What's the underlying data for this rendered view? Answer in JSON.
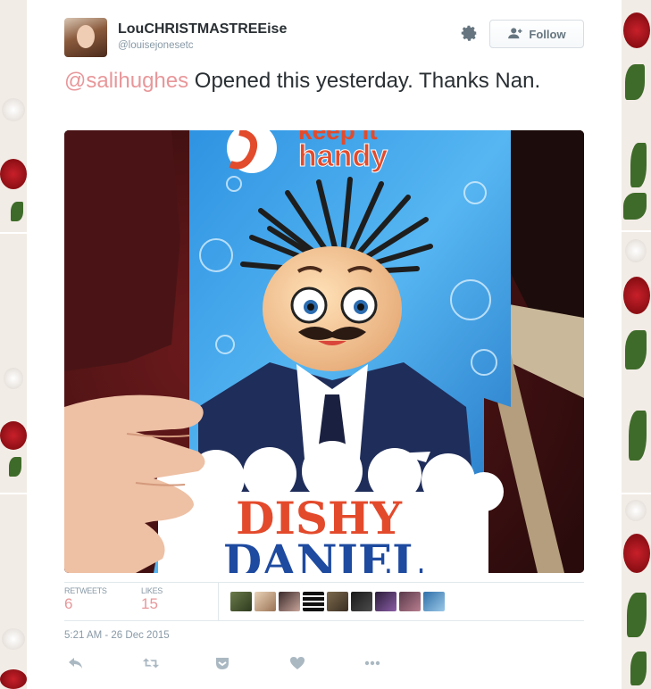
{
  "tweet": {
    "display_name": "LouCHRISTMASTREEise",
    "handle": "@louisejonesetc",
    "follow_label": "Follow",
    "text_mention": "@salihughes",
    "text_body": " Opened this yesterday. Thanks Nan.",
    "timestamp": "5:21 AM - 26 Dec 2015"
  },
  "photo": {
    "package_top_text_1": "keep it",
    "package_top_text_2": "handy",
    "package_title_1": "DISHY",
    "package_title_2": "DANIEL"
  },
  "stats": {
    "retweets_label": "RETWEETS",
    "retweets_count": "6",
    "likes_label": "LIKES",
    "likes_count": "15"
  },
  "icons": {
    "settings": "gear-icon",
    "follow": "person-plus-icon",
    "reply": "reply-icon",
    "retweet": "retweet-icon",
    "save": "pocket-icon",
    "like": "heart-icon",
    "more": "more-dots-icon"
  },
  "colors": {
    "mention": "#e8979a",
    "counts": "#e8979a",
    "muted": "#8899a6"
  }
}
